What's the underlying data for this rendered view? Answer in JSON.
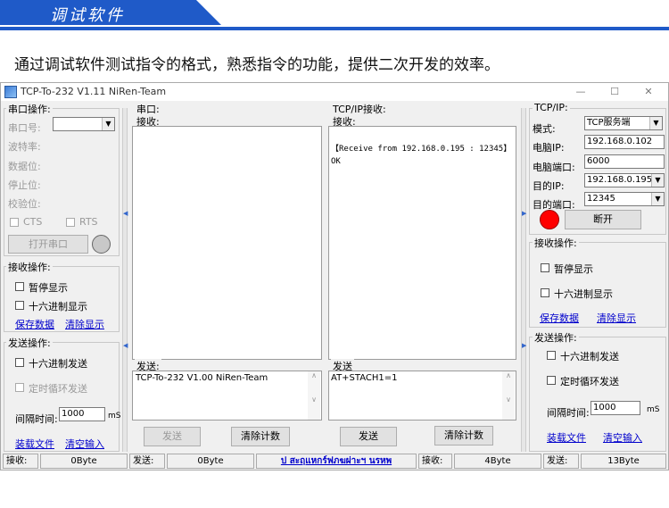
{
  "header": {
    "title": "调试软件",
    "intro": "通过调试软件测试指令的格式，熟悉指令的功能，提供二次开发的效率。"
  },
  "window": {
    "title": "TCP-To-232 V1.11    NiRen-Team",
    "min": "—",
    "max": "☐",
    "close": "✕"
  },
  "serial_ops": {
    "title": "串口操作:",
    "port_label": "串口号:",
    "baud_label": "波特率:",
    "data_label": "数据位:",
    "stop_label": "停止位:",
    "parity_label": "校验位:",
    "cts": "CTS",
    "rts": "RTS",
    "open_button": "打开串口"
  },
  "recv_ops_left": {
    "title": "接收操作:",
    "pause": "暂停显示",
    "hex": "十六进制显示",
    "save": "保存数据",
    "clear": "清除显示"
  },
  "send_ops_left": {
    "title": "发送操作:",
    "hex": "十六进制发送",
    "loop": "定时循环发送",
    "interval_label": "间隔时间:",
    "interval": "1000",
    "unit": "mS",
    "load": "装载文件",
    "clear_input": "清空输入"
  },
  "serial_panel": {
    "title": "串口:",
    "recv_label": "接收:",
    "send_label": "发送:",
    "send_text": "TCP-To-232 V1.00   NiRen-Team",
    "send_button": "发送",
    "clear_count": "清除计数"
  },
  "tcp_panel": {
    "title": "TCP/IP接收:",
    "recv_label": "接收:",
    "recv_text": "【Receive from 192.168.0.195 : 12345】\nOK",
    "send_label": "发送",
    "send_text": "AT+STACH1=1",
    "send_button": "发送",
    "clear_count": "清除计数"
  },
  "tcpip": {
    "title": "TCP/IP:",
    "mode_label": "模式:",
    "mode": "TCP服务端",
    "ip_label": "电脑IP:",
    "ip": "192.168.0.102",
    "port_label": "电脑端口:",
    "port": "6000",
    "dest_ip_label": "目的IP:",
    "dest_ip": "192.168.0.195",
    "dest_port_label": "目的端口:",
    "dest_port": "12345",
    "connect_button": "断开",
    "status_color": "#ff0000"
  },
  "recv_ops_right": {
    "title": "接收操作:",
    "pause": "暂停显示",
    "hex": "十六进制显示",
    "save": "保存数据",
    "clear": "清除显示"
  },
  "send_ops_right": {
    "title": "发送操作:",
    "hex": "十六进制发送",
    "loop": "定时循环发送",
    "interval_label": "间隔时间:",
    "interval": "1000",
    "unit": "mS",
    "load": "装载文件",
    "clear_input": "清空输入"
  },
  "statusbar": {
    "recv1_label": "接收:",
    "recv1": "0Byte",
    "send1_label": "发送:",
    "send1": "0Byte",
    "link": "ป สะฤแหกร์ฟภฆผ่าะฯ นรหพ",
    "recv2_label": "接收:",
    "recv2": "4Byte",
    "send2_label": "发送:",
    "send2": "13Byte"
  },
  "colors": {
    "accent": "#1f5ac8",
    "link": "#0000cc"
  }
}
